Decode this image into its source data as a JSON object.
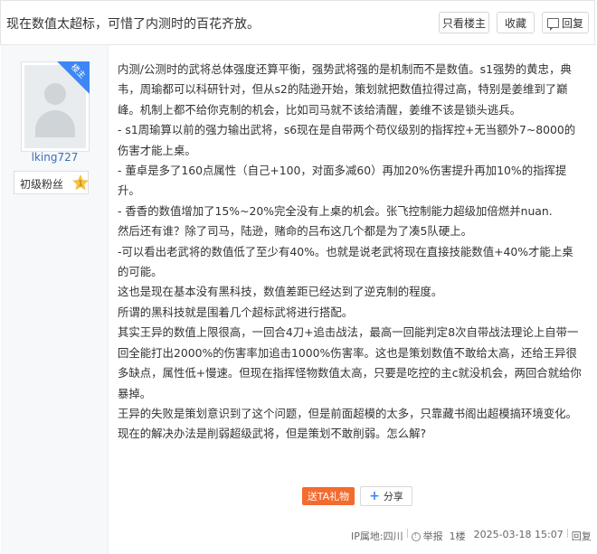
{
  "header": {
    "title": "现在数值太超标，可惜了内测时的百花齐放。",
    "only_op_label": "只看楼主",
    "favorite_label": "收藏",
    "reply_label": "回复"
  },
  "author": {
    "corner_badge": "楼主",
    "username": "lking727",
    "level_title": "初级粉丝",
    "level_number": "1"
  },
  "post": {
    "paragraphs": [
      "内测/公测时的武将总体强度还算平衡，强势武将强的是机制而不是数值。s1强势的黄忠，典韦，周瑜都可以科研针对，但从s2的陆逊开始，策划就把数值拉得过高，特别是姜维到了巅峰。机制上都不给你克制的机会，比如司马就不该给清醒，姜维不该是锁头逃兵。",
      "- s1周瑜算以前的强力输出武将，s6现在是自带两个苟仪级别的指挥控+无当额外7~8000的伤害才能上桌。",
      "- 董卓是多了160点属性（自己+100，对面多减60）再加20%伤害提升再加10%的指挥提升。",
      "- 香香的数值增加了15%~20%完全没有上桌的机会。张飞控制能力超级加倍燃并nuan.",
      "然后还有谁？除了司马，陆逊，赌命的吕布这几个都是为了凑5队硬上。",
      "-可以看出老武将的数值低了至少有40%。也就是说老武将现在直接技能数值+40%才能上桌的可能。",
      "这也是现在基本没有黑科技，数值差距已经达到了逆克制的程度。",
      "所谓的黑科技就是围着几个超标武将进行搭配。",
      "其实王异的数值上限很高，一回合4刀+追击战法，最高一回能判定8次自带战法理论上自带一回全能打出2000%的伤害率加追击1000%伤害率。这也是策划数值不敢给太高，还给王异很多缺点，属性低+慢速。但现在指挥怪物数值太高，只要是吃控的主c就没机会，两回合就给你暴掉。",
      "王异的失败是策划意识到了这个问题，但是前面超模的太多，只靠藏书阁出超模搞环境变化。",
      "现在的解决办法是削弱超级武将，但是策划不敢削弱。怎么解?"
    ]
  },
  "actions": {
    "gift_label": "送TA礼物",
    "share_label": "分享"
  },
  "footer": {
    "ip_location": "IP属地:四川",
    "report_label": "举报",
    "floor": "1楼",
    "timestamp": "2025-03-18 15:07",
    "reply_label": "回复"
  },
  "colors": {
    "accent_blue": "#3d86f5",
    "gift_orange": "#f36b2e",
    "username_blue": "#3a6fb7",
    "sidebar_bg": "#f7f8fa",
    "badge_gold": "#f5c242"
  }
}
